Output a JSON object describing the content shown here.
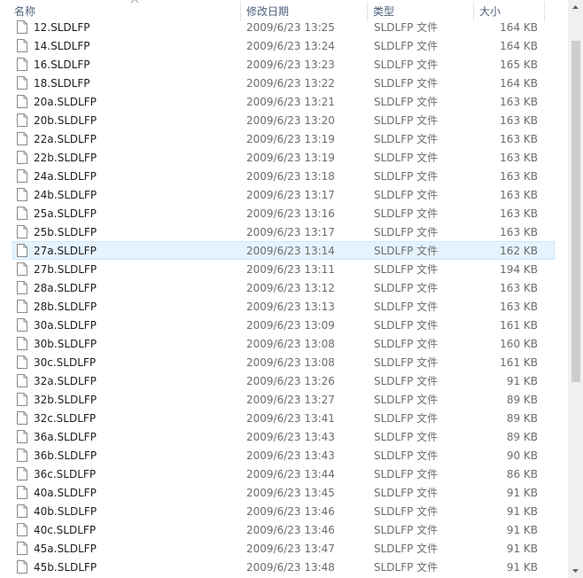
{
  "columns": {
    "name": "名称",
    "date": "修改日期",
    "type": "类型",
    "size": "大小"
  },
  "sort": {
    "column": "name",
    "icon": "sort-up-arrow-icon"
  },
  "selected_index": 12,
  "files": [
    {
      "name": "12.SLDLFP",
      "date": "2009/6/23 13:25",
      "type": "SLDLFP 文件",
      "size": "164 KB"
    },
    {
      "name": "14.SLDLFP",
      "date": "2009/6/23 13:24",
      "type": "SLDLFP 文件",
      "size": "164 KB"
    },
    {
      "name": "16.SLDLFP",
      "date": "2009/6/23 13:23",
      "type": "SLDLFP 文件",
      "size": "165 KB"
    },
    {
      "name": "18.SLDLFP",
      "date": "2009/6/23 13:22",
      "type": "SLDLFP 文件",
      "size": "164 KB"
    },
    {
      "name": "20a.SLDLFP",
      "date": "2009/6/23 13:21",
      "type": "SLDLFP 文件",
      "size": "163 KB"
    },
    {
      "name": "20b.SLDLFP",
      "date": "2009/6/23 13:20",
      "type": "SLDLFP 文件",
      "size": "163 KB"
    },
    {
      "name": "22a.SLDLFP",
      "date": "2009/6/23 13:19",
      "type": "SLDLFP 文件",
      "size": "163 KB"
    },
    {
      "name": "22b.SLDLFP",
      "date": "2009/6/23 13:19",
      "type": "SLDLFP 文件",
      "size": "163 KB"
    },
    {
      "name": "24a.SLDLFP",
      "date": "2009/6/23 13:18",
      "type": "SLDLFP 文件",
      "size": "163 KB"
    },
    {
      "name": "24b.SLDLFP",
      "date": "2009/6/23 13:17",
      "type": "SLDLFP 文件",
      "size": "163 KB"
    },
    {
      "name": "25a.SLDLFP",
      "date": "2009/6/23 13:16",
      "type": "SLDLFP 文件",
      "size": "163 KB"
    },
    {
      "name": "25b.SLDLFP",
      "date": "2009/6/23 13:17",
      "type": "SLDLFP 文件",
      "size": "163 KB"
    },
    {
      "name": "27a.SLDLFP",
      "date": "2009/6/23 13:14",
      "type": "SLDLFP 文件",
      "size": "162 KB"
    },
    {
      "name": "27b.SLDLFP",
      "date": "2009/6/23 13:11",
      "type": "SLDLFP 文件",
      "size": "194 KB"
    },
    {
      "name": "28a.SLDLFP",
      "date": "2009/6/23 13:12",
      "type": "SLDLFP 文件",
      "size": "163 KB"
    },
    {
      "name": "28b.SLDLFP",
      "date": "2009/6/23 13:13",
      "type": "SLDLFP 文件",
      "size": "163 KB"
    },
    {
      "name": "30a.SLDLFP",
      "date": "2009/6/23 13:09",
      "type": "SLDLFP 文件",
      "size": "161 KB"
    },
    {
      "name": "30b.SLDLFP",
      "date": "2009/6/23 13:08",
      "type": "SLDLFP 文件",
      "size": "160 KB"
    },
    {
      "name": "30c.SLDLFP",
      "date": "2009/6/23 13:08",
      "type": "SLDLFP 文件",
      "size": "161 KB"
    },
    {
      "name": "32a.SLDLFP",
      "date": "2009/6/23 13:26",
      "type": "SLDLFP 文件",
      "size": "91 KB"
    },
    {
      "name": "32b.SLDLFP",
      "date": "2009/6/23 13:27",
      "type": "SLDLFP 文件",
      "size": "89 KB"
    },
    {
      "name": "32c.SLDLFP",
      "date": "2009/6/23 13:41",
      "type": "SLDLFP 文件",
      "size": "89 KB"
    },
    {
      "name": "36a.SLDLFP",
      "date": "2009/6/23 13:43",
      "type": "SLDLFP 文件",
      "size": "89 KB"
    },
    {
      "name": "36b.SLDLFP",
      "date": "2009/6/23 13:43",
      "type": "SLDLFP 文件",
      "size": "90 KB"
    },
    {
      "name": "36c.SLDLFP",
      "date": "2009/6/23 13:44",
      "type": "SLDLFP 文件",
      "size": "86 KB"
    },
    {
      "name": "40a.SLDLFP",
      "date": "2009/6/23 13:45",
      "type": "SLDLFP 文件",
      "size": "91 KB"
    },
    {
      "name": "40b.SLDLFP",
      "date": "2009/6/23 13:46",
      "type": "SLDLFP 文件",
      "size": "91 KB"
    },
    {
      "name": "40c.SLDLFP",
      "date": "2009/6/23 13:46",
      "type": "SLDLFP 文件",
      "size": "91 KB"
    },
    {
      "name": "45a.SLDLFP",
      "date": "2009/6/23 13:47",
      "type": "SLDLFP 文件",
      "size": "91 KB"
    },
    {
      "name": "45b.SLDLFP",
      "date": "2009/6/23 13:48",
      "type": "SLDLFP 文件",
      "size": "91 KB"
    }
  ],
  "colors": {
    "header_text": "#4c607a",
    "selection_bg": "#e5f3ff",
    "selection_border": "#cce8ff",
    "secondary_text": "#6d6d6d"
  },
  "icons": {
    "file": "file-icon",
    "scroll_up": "scroll-up-arrow-icon",
    "scroll_down": "scroll-down-arrow-icon"
  }
}
